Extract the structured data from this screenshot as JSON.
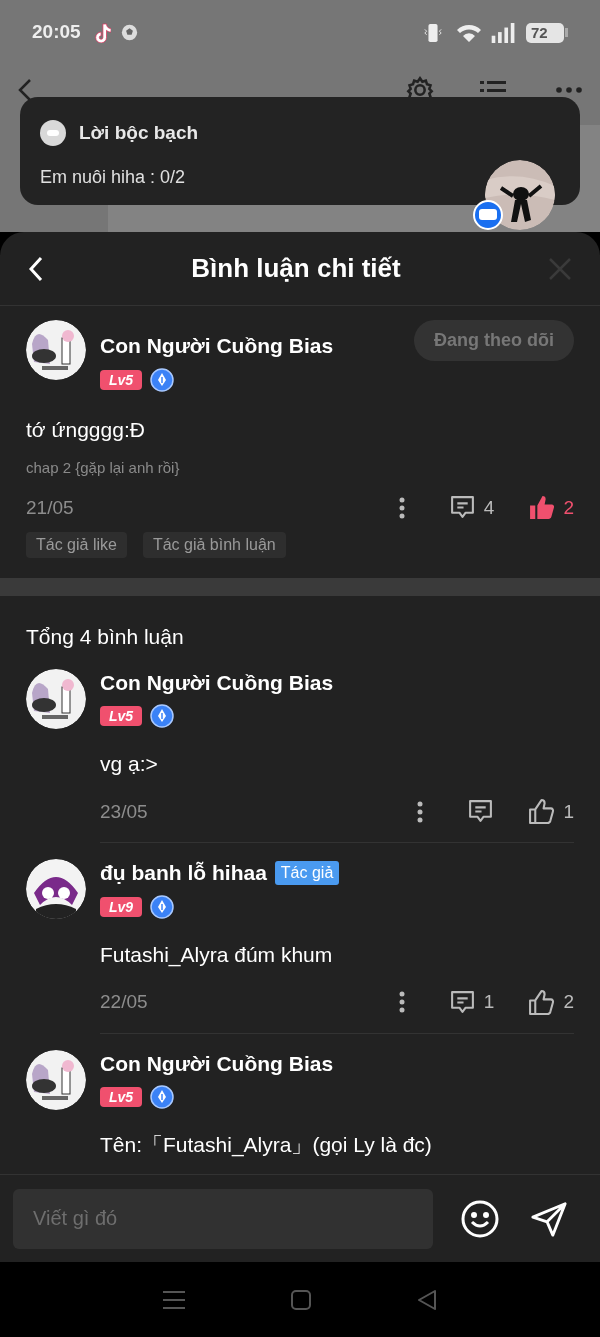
{
  "status_bar": {
    "time": "20:05",
    "battery": "72"
  },
  "notification": {
    "title": "Lời bộc bạch",
    "text": "Em nuôi hiha : 0/2"
  },
  "sheet": {
    "title": "Bình luận chi tiết"
  },
  "main_comment": {
    "author": "Con Người Cuồng Bias",
    "level": "Lv5",
    "follow_button": "Đang theo dõi",
    "text": "tớ ứngggg:Đ",
    "chapter": "chap 2 {gặp lại anh rồi}",
    "date": "21/05",
    "reply_count": "4",
    "like_count": "2",
    "liked": true,
    "tags": [
      "Tác giả like",
      "Tác giả bình luận"
    ]
  },
  "total": "Tổng 4 bình luận",
  "replies": [
    {
      "author": "Con Người Cuồng Bias",
      "level": "Lv5",
      "text": "vg ạ:>",
      "date": "23/05",
      "like_count": "1",
      "liked": false
    },
    {
      "author": "đụ banh lỗ hihaa",
      "author_badge": "Tác giả",
      "level": "Lv9",
      "text": "Futashi_Alyra đúm khum",
      "date": "22/05",
      "reply_count": "1",
      "like_count": "2",
      "liked": false
    },
    {
      "author": "Con Người Cuồng Bias",
      "level": "Lv5",
      "text": "Tên:「Futashi_Alyra」(gọi Ly là đc)"
    }
  ],
  "input": {
    "placeholder": "Viết gì đó"
  }
}
